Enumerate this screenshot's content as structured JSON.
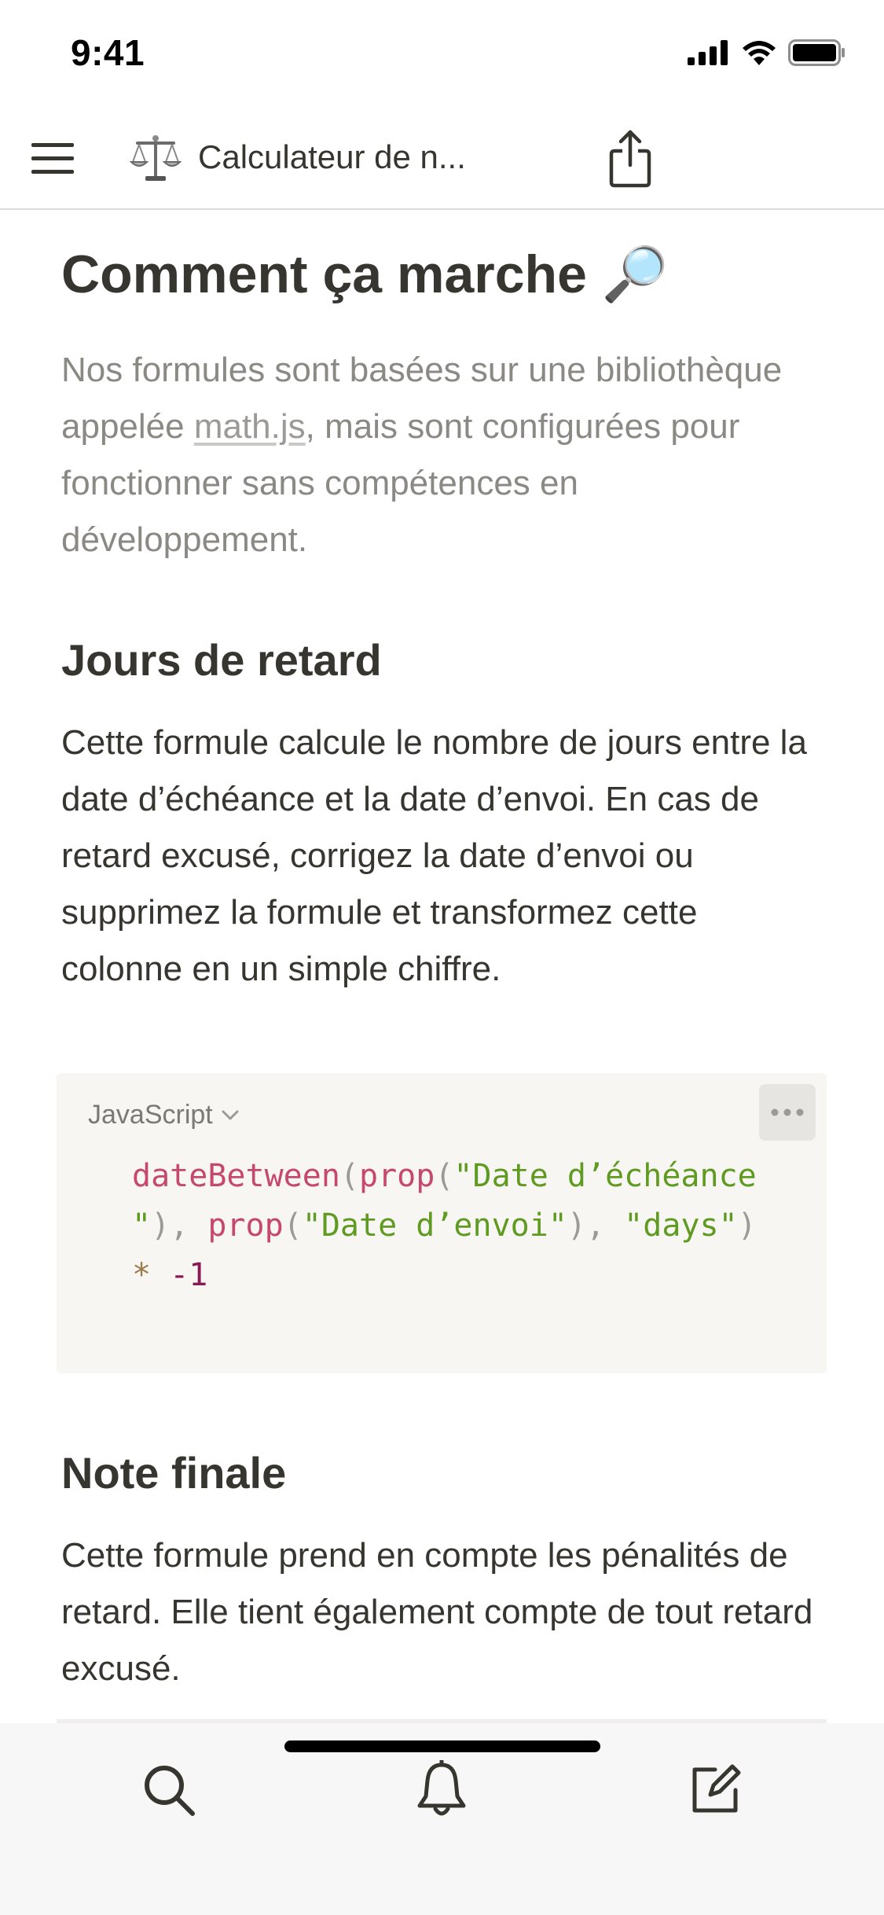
{
  "status_bar": {
    "time": "9:41"
  },
  "nav": {
    "page_title": "Calculateur de n...",
    "page_icon": "balance-scale-icon"
  },
  "content": {
    "heading": "Comment ça marche 🔎",
    "intro_before_link": "Nos formules sont basées sur une bibliothèque appelée ",
    "intro_link": "math.js",
    "intro_after_link": ", mais sont configurées pour fonctionner sans compétences en développement.",
    "section1_title": "Jours de retard",
    "section1_text": "Cette formule calcule le nombre de jours entre la date d’échéance et la date d’envoi. En cas de retard excusé, corrigez la date d’envoi ou supprimez la formule et transformez cette colonne en un simple chiffre.",
    "code": {
      "language": "JavaScript",
      "tokens": {
        "t1": "dateBetween",
        "t2": "(",
        "t3": "prop",
        "t4": "(",
        "t5": "\"Date d’échéance",
        "t6": "\"",
        "t7": "), ",
        "t8": "prop",
        "t9": "(",
        "t10": "\"Date d’envoi\"",
        "t11": "), ",
        "t12": "\"days\"",
        "t13": ")",
        "t14": "*",
        "t15": " ",
        "t16": "-1"
      }
    },
    "section2_title": "Note finale",
    "section2_text": "Cette formule prend en compte les pénalités de retard. Elle tient également compte de tout retard excusé."
  },
  "bottom_bar": {
    "search_icon": "search-icon",
    "notifications_icon": "bell-icon",
    "compose_icon": "compose-icon"
  }
}
